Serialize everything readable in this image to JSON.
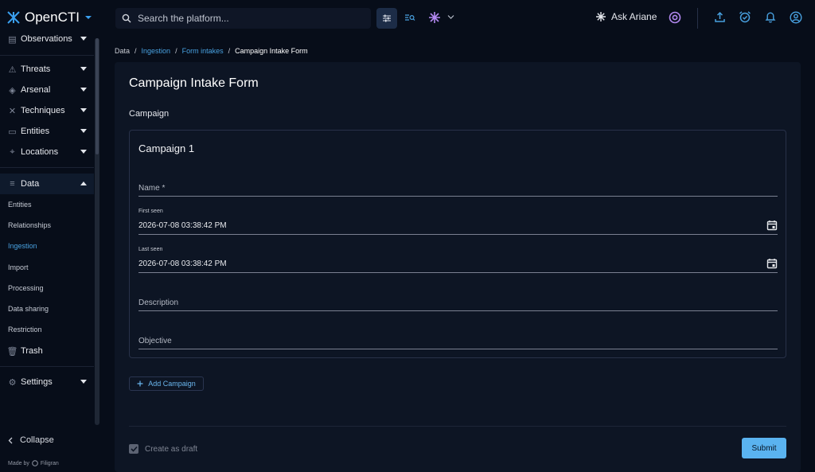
{
  "app": {
    "name": "OpenCTI"
  },
  "search": {
    "placeholder": "Search the platform..."
  },
  "header": {
    "ask_label": "Ask Ariane"
  },
  "sidebar": {
    "partial_top": "Observations",
    "items": [
      {
        "label": "Threats"
      },
      {
        "label": "Arsenal"
      },
      {
        "label": "Techniques"
      },
      {
        "label": "Entities"
      },
      {
        "label": "Locations"
      },
      {
        "label": "Data"
      }
    ],
    "data_sub": [
      "Entities",
      "Relationships",
      "Ingestion",
      "Import",
      "Processing",
      "Data sharing",
      "Restriction"
    ],
    "trash": "Trash",
    "settings": "Settings",
    "collapse": "Collapse",
    "made_by": "Made by",
    "made_by_brand": "Filigran"
  },
  "breadcrumb": [
    "Data",
    "Ingestion",
    "Form intakes",
    "Campaign Intake Form"
  ],
  "form": {
    "title": "Campaign Intake Form",
    "section": "Campaign",
    "card_title": "Campaign 1",
    "name_placeholder": "Name *",
    "first_seen_label": "First seen",
    "first_seen_value": "2026-07-08 03:38:42 PM",
    "last_seen_label": "Last seen",
    "last_seen_value": "2026-07-08 03:38:42 PM",
    "description_placeholder": "Description",
    "objective_placeholder": "Objective",
    "add_label": "Add Campaign",
    "draft_label": "Create as draft",
    "submit_label": "Submit"
  },
  "colors": {
    "accent": "#48a1e0",
    "submit": "#5ab3f0",
    "background": "#070d19",
    "panel": "#0d1524"
  }
}
